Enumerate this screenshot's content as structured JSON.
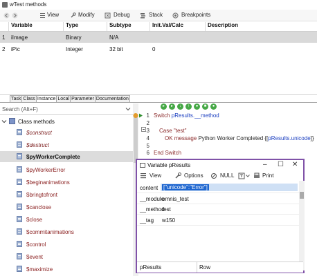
{
  "window": {
    "title": "wTest methods"
  },
  "toolbar": {
    "items": [
      {
        "icon": "back-arrow-icon",
        "label": ""
      },
      {
        "icon": "forward-arrow-icon",
        "label": ""
      },
      {
        "icon": "list-icon",
        "label": "View"
      },
      {
        "icon": "wrench-icon",
        "label": "Modify"
      },
      {
        "icon": "debug-icon",
        "label": "Debug"
      },
      {
        "icon": "stack-icon",
        "label": "Stack"
      },
      {
        "icon": "breakpoint-icon",
        "label": "Breakpoints"
      }
    ]
  },
  "variables": {
    "columns": [
      "Variable",
      "Type",
      "Subtype",
      "Init.Val/Calc",
      "Description"
    ],
    "rows": [
      {
        "num": "1",
        "variable": "iImage",
        "type": "Binary",
        "subtype": "N/A",
        "init": "",
        "description": ""
      },
      {
        "num": "2",
        "variable": "iPic",
        "type": "Integer",
        "subtype": "32 bit",
        "init": "0",
        "description": ""
      }
    ]
  },
  "tabs": [
    "Task",
    "Class",
    "Instance",
    "Local",
    "Parameter",
    "Documentation"
  ],
  "search": {
    "placeholder": "Search (Alt+F)"
  },
  "tree": {
    "group": "Class methods",
    "items": [
      {
        "label": "$construct",
        "style": "red"
      },
      {
        "label": "$destruct",
        "style": "red"
      },
      {
        "label": "$pyWorkerComplete",
        "style": "selected"
      },
      {
        "label": "$pyWorkerError",
        "style": "dark"
      },
      {
        "label": "$beginanimations",
        "style": "dark"
      },
      {
        "label": "$bringtofront",
        "style": "dark"
      },
      {
        "label": "$canclose",
        "style": "dark"
      },
      {
        "label": "$close",
        "style": "dark"
      },
      {
        "label": "$commitanimations",
        "style": "dark"
      },
      {
        "label": "$control",
        "style": "dark"
      },
      {
        "label": "$event",
        "style": "dark"
      },
      {
        "label": "$maximize",
        "style": "dark"
      }
    ]
  },
  "code": {
    "lines": [
      {
        "num": "1",
        "parts": [
          {
            "t": "Switch ",
            "c": "kw"
          },
          {
            "t": "pResults.__method",
            "c": "var"
          }
        ]
      },
      {
        "num": "2",
        "parts": []
      },
      {
        "num": "3",
        "parts": [
          {
            "t": "Case ",
            "c": "kw"
          },
          {
            "t": "\"test\"",
            "c": "str"
          }
        ]
      },
      {
        "num": "4",
        "parts": [
          {
            "t": "OK message ",
            "c": "kw"
          },
          {
            "t": "Python Worker Completed {[",
            "c": "plain"
          },
          {
            "t": "pResults.unicode",
            "c": "var"
          },
          {
            "t": "]}",
            "c": "plain"
          }
        ]
      },
      {
        "num": "5",
        "parts": []
      },
      {
        "num": "6",
        "parts": [
          {
            "t": "End Switch",
            "c": "kw"
          }
        ]
      }
    ]
  },
  "popup": {
    "title": "Variable pResults",
    "toolbar": [
      "View",
      "Options",
      "NULL",
      "Print"
    ],
    "rows": [
      {
        "label": "content",
        "value": "[\"unicode\":\"Error\"]"
      },
      {
        "label": "__module",
        "value": "omnis_test"
      },
      {
        "label": "__method",
        "value": "test"
      },
      {
        "label": "__tag",
        "value": "w150"
      }
    ],
    "status": {
      "left": "pResults",
      "right": "Row"
    }
  }
}
